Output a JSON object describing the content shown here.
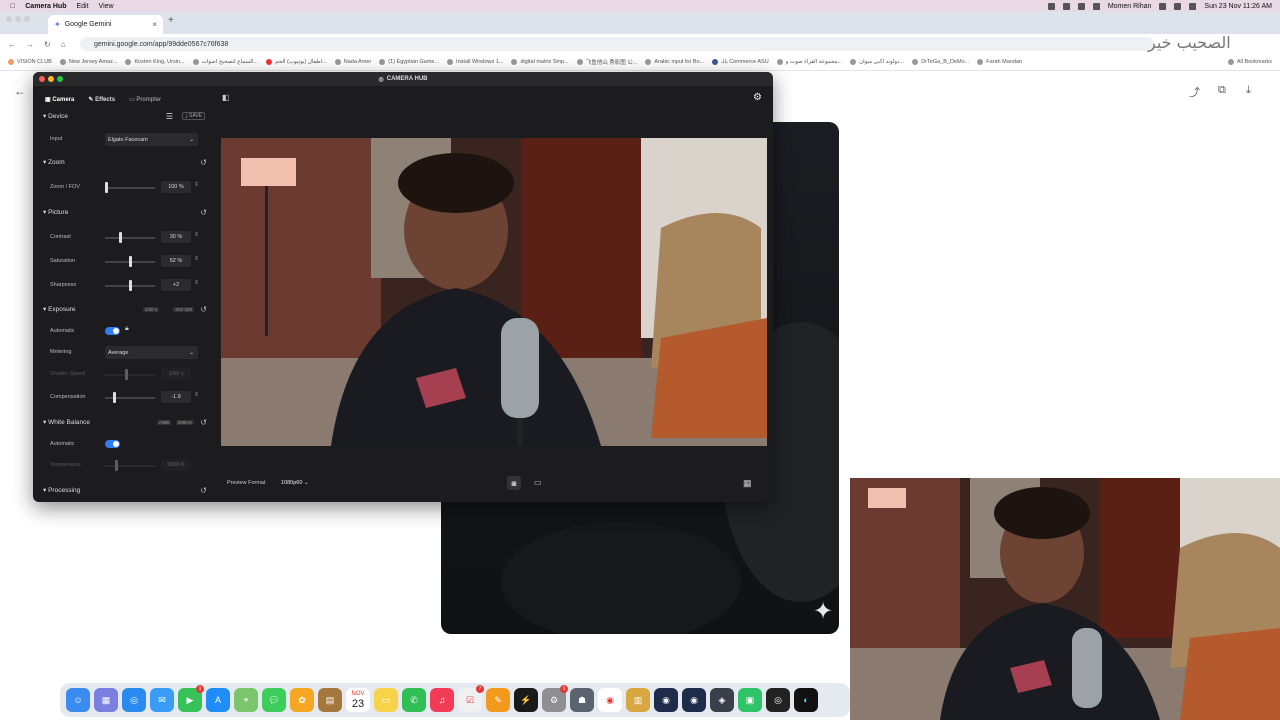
{
  "menubar": {
    "apple": "",
    "app": "Camera Hub",
    "items": [
      "Edit",
      "View"
    ],
    "user": "Momen Rihan",
    "datetime": "Sun 23 Nov  11:26 AM"
  },
  "browser": {
    "tab_title": "Google Gemini",
    "url": "gemini.google.com/app/99dde0567c76f638",
    "new_tab": "+",
    "close_tab": "×",
    "bookmarks": [
      "VISION CLUB",
      "New Jersey Amaz...",
      "Kirsten King, Ursin...",
      "السماع لتصحيح اصوات...",
      "اطفال (يوتيوب) الحم...",
      "Nada Amer",
      "(1) Egyptian Game...",
      "Install Windows 1...",
      "digital matrix Smp...",
      "飞鱼他山 秀影图 公...",
      "Arabic input for Bo...",
      "بالـ Commerce ASU",
      "مجموعة القراء صوت و...",
      "دولوند اكبى ميوان...",
      "DrTeGa_B_DeMo...",
      "Farah Mandan"
    ],
    "all_bookmarks": "All Bookmarks"
  },
  "camerahub": {
    "title": "CAMERA HUB",
    "tabs": [
      "Camera",
      "Effects",
      "Prompter"
    ],
    "device": {
      "label": "Device",
      "save": "SAVE",
      "input_label": "Input",
      "input_value": "Elgato Facecam"
    },
    "zoom": {
      "label": "Zoom",
      "fov_label": "Zoom / FOV",
      "fov_value": "100 %",
      "fov": 1.0
    },
    "picture": {
      "label": "Picture",
      "rows": [
        {
          "name": "Contrast",
          "value": "30 %",
          "level": 0.3
        },
        {
          "name": "Saturation",
          "value": "52 %",
          "level": 0.52
        },
        {
          "name": "Sharpness",
          "value": "+2",
          "level": 0.52
        }
      ]
    },
    "exposure": {
      "label": "Exposure",
      "badge1": "1/60 s",
      "badge2": "ISO",
      "badge3": "320",
      "auto_label": "Automatic",
      "metering_label": "Metering",
      "metering_value": "Average",
      "shutter_label": "Shutter Speed",
      "shutter_value": "1/60 s",
      "shutter": 0.42,
      "comp_label": "Compensation",
      "comp_value": "-1.9",
      "comp": 0.16
    },
    "white_balance": {
      "label": "White Balance",
      "badge1": "AWB",
      "badge2": "2800 K",
      "auto_label": "Automatic",
      "temp_label": "Temperature",
      "temp_value": "5000 K",
      "temp": 0.22
    },
    "processing": {
      "label": "Processing"
    },
    "footer": {
      "preview_format_label": "Preview Format",
      "preview_format_value": "1080p60"
    }
  },
  "colors": {
    "accent": "#2f7cf6",
    "panel": "#1c1c1e"
  },
  "watermark": "الصحيب خير",
  "dock": {
    "calendar_month": "NOV",
    "calendar_day": "23",
    "apps": [
      "finder-icon",
      "launchpad-icon",
      "safari-icon",
      "mail-icon",
      "facetime-icon",
      "appstore-icon",
      "maps-icon",
      "messages-icon",
      "photos-icon",
      "notes-icon",
      "calendar-icon",
      "stickies-icon",
      "whatsapp-icon",
      "music-icon",
      "reminders-icon",
      "pages-icon",
      "terminal-icon",
      "settings-icon",
      "preview-icon",
      "chrome-icon",
      "archive-icon",
      "audio-icon",
      "audio2-icon",
      "vpn-icon",
      "app-icon",
      "obs-icon",
      "gemini-icon"
    ]
  }
}
